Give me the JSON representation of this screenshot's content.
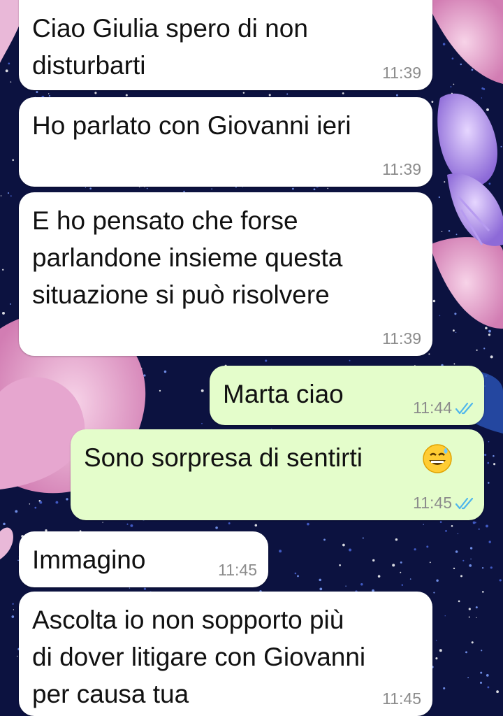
{
  "chat": {
    "messages": [
      {
        "direction": "in",
        "text": "Ciao Giulia spero di non\ndisturbarti",
        "time": "11:39"
      },
      {
        "direction": "in",
        "text": "Ho parlato con Giovanni ieri",
        "time": "11:39"
      },
      {
        "direction": "in",
        "text": "E ho pensato che forse\nparlandone insieme questa\nsituazione si può risolvere",
        "time": "11:39"
      },
      {
        "direction": "out",
        "text": "Marta ciao",
        "time": "11:44",
        "status": "read-double-check-icon"
      },
      {
        "direction": "out",
        "text": "Sono sorpresa di sentirti",
        "emoji": "grinning-face-with-sweat-emoji",
        "time": "11:45",
        "status": "read-double-check-icon"
      },
      {
        "direction": "in",
        "text": "Immagino",
        "time": "11:45"
      },
      {
        "direction": "in",
        "text": "Ascolta io non sopporto più\ndi dover litigare con Giovanni\nper causa tua",
        "time": "11:45"
      }
    ]
  },
  "colors": {
    "incoming_bubble": "#ffffff",
    "outgoing_bubble": "#e4fdcb",
    "read_ticks": "#4fb6ec",
    "timestamp": "#8c8c8c"
  }
}
